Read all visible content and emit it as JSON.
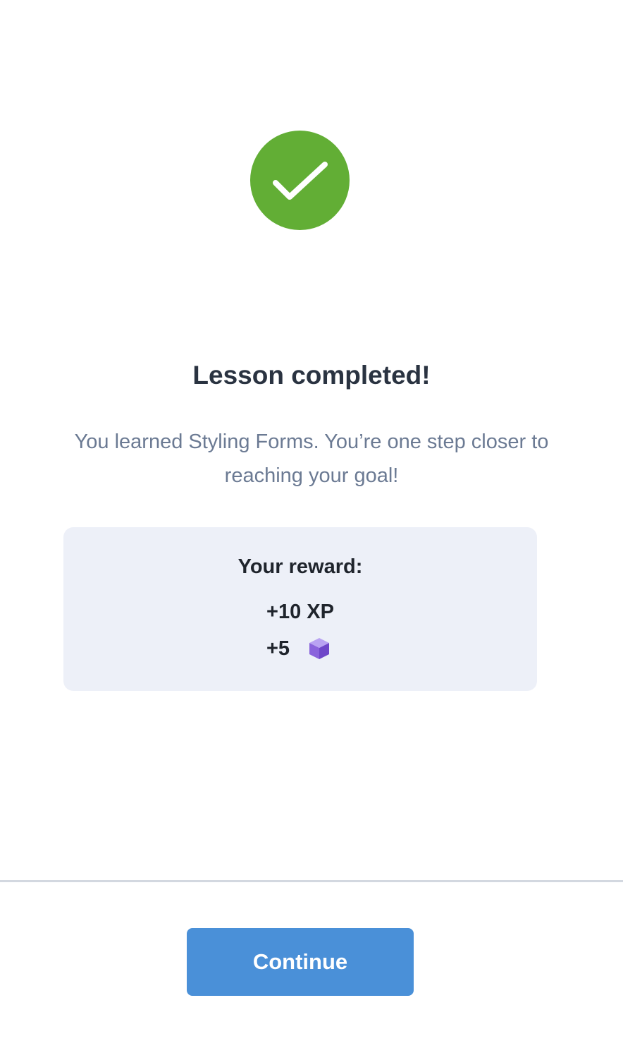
{
  "header": {
    "icon": "checkmark-circle-icon",
    "icon_color": "#62ae35",
    "title": "Lesson completed!",
    "subtitle": "You learned Styling Forms. You’re one step closer to reaching your goal!"
  },
  "reward": {
    "heading": "Your reward:",
    "xp": "+10 XP",
    "gems": "+5",
    "gem_icon": "purple-cube-icon",
    "gem_color": "#8f6ce0",
    "card_color": "#edf0f8"
  },
  "footer": {
    "continue_label": "Continue",
    "button_color": "#4a90d8"
  }
}
